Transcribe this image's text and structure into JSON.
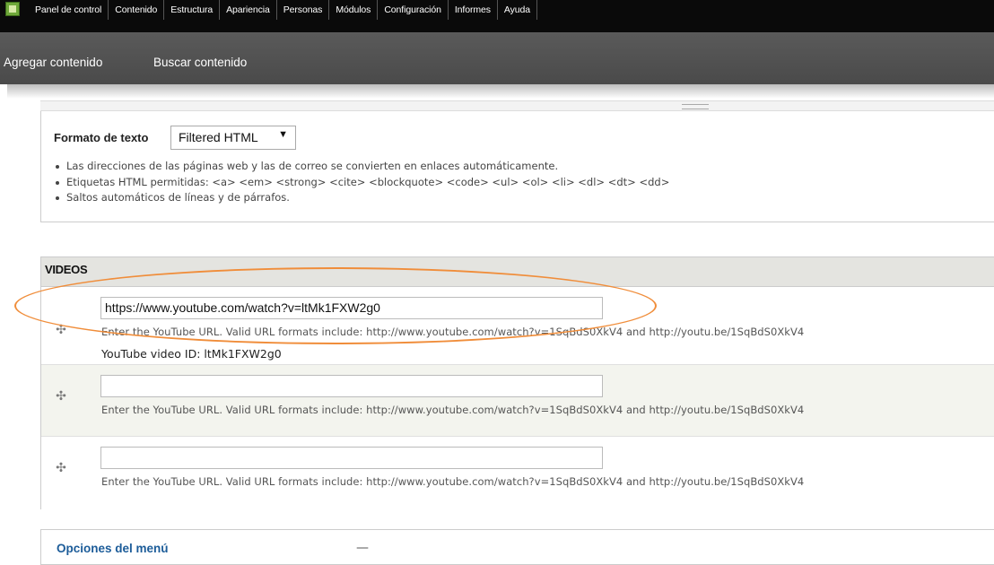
{
  "toolbar": {
    "items": [
      "Panel de control",
      "Contenido",
      "Estructura",
      "Apariencia",
      "Personas",
      "Módulos",
      "Configuración",
      "Informes",
      "Ayuda"
    ]
  },
  "shortcuts": {
    "add_content": "Agregar contenido",
    "find_content": "Buscar contenido"
  },
  "text_format": {
    "label": "Formato de texto",
    "selected": "Filtered HTML",
    "tips": [
      "Las direcciones de las páginas web y las de correo se convierten en enlaces automáticamente.",
      "Etiquetas HTML permitidas: <a> <em> <strong> <cite> <blockquote> <code> <ul> <ol> <li> <dl> <dt> <dd>",
      "Saltos automáticos de líneas y de párrafos."
    ]
  },
  "videos": {
    "heading": "VIDEOS",
    "rows": [
      {
        "value": "https://www.youtube.com/watch?v=ltMk1FXW2g0",
        "help": "Enter the YouTube URL. Valid URL formats include: http://www.youtube.com/watch?v=1SqBdS0XkV4 and http://youtu.be/1SqBdS0XkV4",
        "video_id": "YouTube video ID: ltMk1FXW2g0"
      },
      {
        "value": "",
        "help": "Enter the YouTube URL. Valid URL formats include: http://www.youtube.com/watch?v=1SqBdS0XkV4 and http://youtu.be/1SqBdS0XkV4"
      },
      {
        "value": "",
        "help": "Enter the YouTube URL. Valid URL formats include: http://www.youtube.com/watch?v=1SqBdS0XkV4 and http://youtu.be/1SqBdS0XkV4"
      }
    ]
  },
  "menu_options": {
    "title": "Opciones del menú",
    "toggle": "—"
  },
  "icons": {
    "home": "home-icon",
    "drag": "drag-handle-icon",
    "dropdown": "chevron-down-icon"
  },
  "colors": {
    "toolbar_bg": "#0a0a0a",
    "shortcut_bg": "#4f4f4f",
    "highlight_ellipse": "#f08d3a",
    "link": "#1c5c99"
  }
}
